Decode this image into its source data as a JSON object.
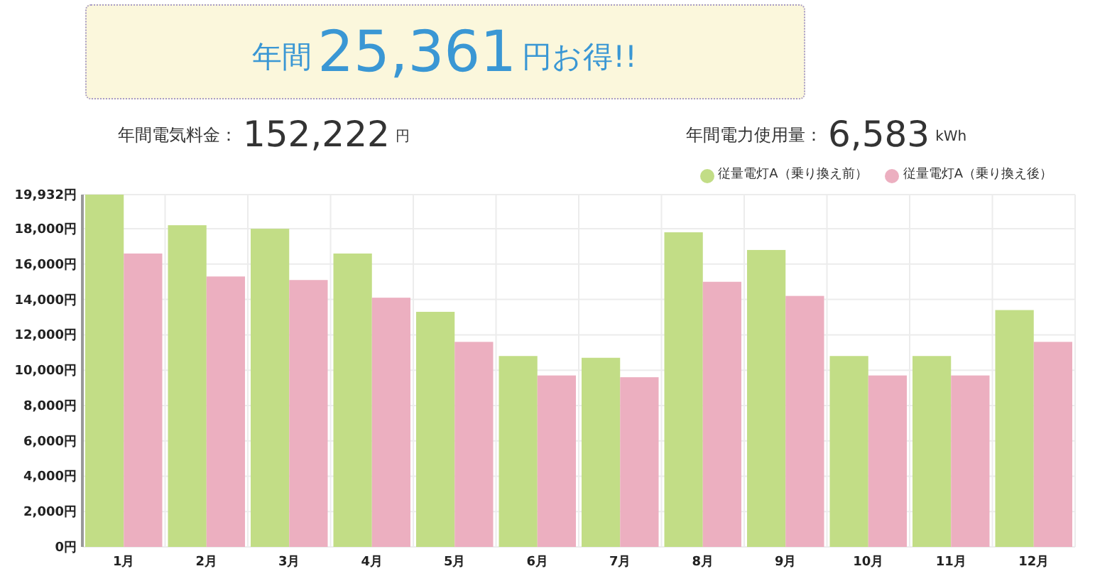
{
  "banner": {
    "prefix": "年間",
    "amount": "25,361",
    "suffix": "円お得!!"
  },
  "stats": [
    {
      "label": "年間電気料金：",
      "value": "152,222",
      "unit": "円"
    },
    {
      "label": "年間電力使用量：",
      "value": "6,583",
      "unit": "kWh"
    }
  ],
  "chart_data": {
    "type": "bar",
    "categories": [
      "1月",
      "2月",
      "3月",
      "4月",
      "5月",
      "6月",
      "7月",
      "8月",
      "9月",
      "10月",
      "11月",
      "12月"
    ],
    "series": [
      {
        "name": "従量電灯A（乗り換え前）",
        "color": "#c2dd86",
        "values": [
          19932,
          18200,
          18000,
          16600,
          13300,
          10800,
          10700,
          17800,
          16800,
          10800,
          10800,
          13400
        ]
      },
      {
        "name": "従量電灯A（乗り換え後）",
        "color": "#ecafc0",
        "values": [
          16600,
          15300,
          15100,
          14100,
          11600,
          9700,
          9600,
          15000,
          14200,
          9700,
          9700,
          11600
        ]
      }
    ],
    "grid": true,
    "ylim": [
      0,
      19932
    ],
    "yticks": [
      {
        "value": 0,
        "label": "0円"
      },
      {
        "value": 2000,
        "label": "2,000円"
      },
      {
        "value": 4000,
        "label": "4,000円"
      },
      {
        "value": 6000,
        "label": "6,000円"
      },
      {
        "value": 8000,
        "label": "8,000円"
      },
      {
        "value": 10000,
        "label": "10,000円"
      },
      {
        "value": 12000,
        "label": "12,000円"
      },
      {
        "value": 14000,
        "label": "14,000円"
      },
      {
        "value": 16000,
        "label": "16,000円"
      },
      {
        "value": 18000,
        "label": "18,000円"
      },
      {
        "value": 19932,
        "label": "19,932円"
      }
    ]
  }
}
